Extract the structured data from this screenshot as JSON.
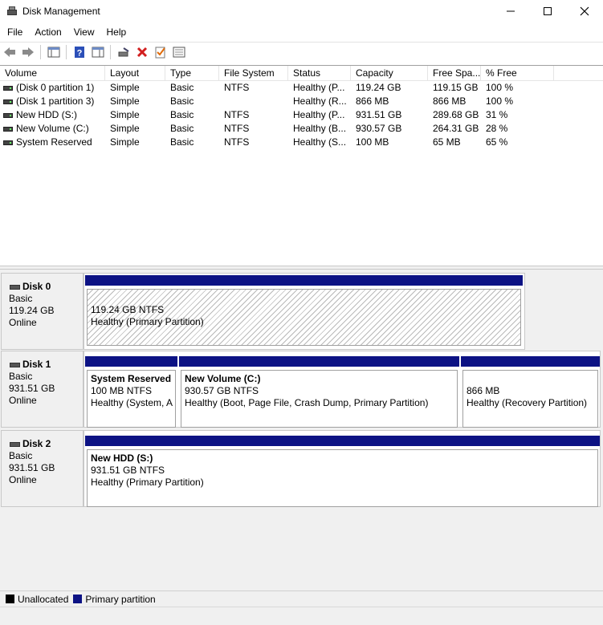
{
  "window": {
    "title": "Disk Management"
  },
  "menu": [
    {
      "label": "File"
    },
    {
      "label": "Action"
    },
    {
      "label": "View"
    },
    {
      "label": "Help"
    }
  ],
  "columns": [
    "Volume",
    "Layout",
    "Type",
    "File System",
    "Status",
    "Capacity",
    "Free Spa...",
    "% Free"
  ],
  "volumes": [
    [
      "(Disk 0 partition 1)",
      "Simple",
      "Basic",
      "NTFS",
      "Healthy (P...",
      "119.24 GB",
      "119.15 GB",
      "100 %"
    ],
    [
      "(Disk 1 partition 3)",
      "Simple",
      "Basic",
      "",
      "Healthy (R...",
      "866 MB",
      "866 MB",
      "100 %"
    ],
    [
      "New HDD (S:)",
      "Simple",
      "Basic",
      "NTFS",
      "Healthy (P...",
      "931.51 GB",
      "289.68 GB",
      "31 %"
    ],
    [
      "New Volume (C:)",
      "Simple",
      "Basic",
      "NTFS",
      "Healthy (B...",
      "930.57 GB",
      "264.31 GB",
      "28 %"
    ],
    [
      "System Reserved",
      "Simple",
      "Basic",
      "NTFS",
      "Healthy (S...",
      "100 MB",
      "65 MB",
      "65 %"
    ]
  ],
  "disks": [
    {
      "name": "Disk 0",
      "type": "Basic",
      "size": "119.24 GB",
      "state": "Online",
      "partitions": [
        {
          "name": "",
          "size": "119.24 GB NTFS",
          "status": "Healthy (Primary Partition)"
        }
      ]
    },
    {
      "name": "Disk 1",
      "type": "Basic",
      "size": "931.51 GB",
      "state": "Online",
      "partitions": [
        {
          "name": "System Reserved",
          "size": "100 MB NTFS",
          "status": "Healthy (System, A"
        },
        {
          "name": "New Volume  (C:)",
          "size": "930.57 GB NTFS",
          "status": "Healthy (Boot, Page File, Crash Dump, Primary Partition)"
        },
        {
          "name": "",
          "size": "866 MB",
          "status": "Healthy (Recovery Partition)"
        }
      ]
    },
    {
      "name": "Disk 2",
      "type": "Basic",
      "size": "931.51 GB",
      "state": "Online",
      "partitions": [
        {
          "name": "New HDD  (S:)",
          "size": "931.51 GB NTFS",
          "status": "Healthy (Primary Partition)"
        }
      ]
    }
  ],
  "legend": [
    {
      "label": "Unallocated",
      "color": "#000000"
    },
    {
      "label": "Primary partition",
      "color": "#0c1284"
    }
  ]
}
